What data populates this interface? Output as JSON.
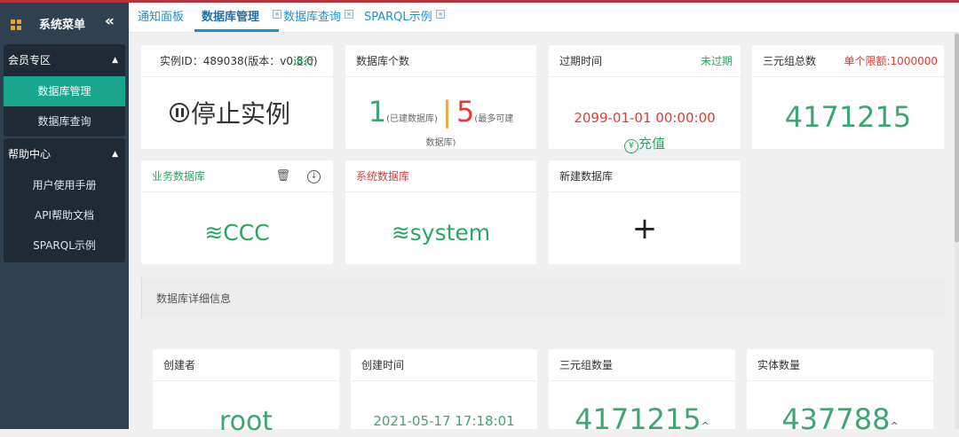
{
  "sidebar": {
    "title": "系统菜单",
    "collapse_icon": "«",
    "sections": [
      {
        "label": "会员专区",
        "items": [
          "数据库管理",
          "数据库查询"
        ],
        "active_index": 0
      },
      {
        "label": "帮助中心",
        "items": [
          "用户使用手册",
          "API帮助文档",
          "SPARQL示例"
        ]
      }
    ]
  },
  "tabs": [
    {
      "label": "通知面板"
    },
    {
      "label": "数据库管理",
      "active": true
    },
    {
      "label": "数据库查询"
    },
    {
      "label": "SPARQL示例"
    }
  ],
  "instance": {
    "title": "实例ID：489038(版本：v0.8.0)",
    "status": "运行",
    "action": "停止实例"
  },
  "db_count": {
    "title": "数据库个数",
    "created": "1",
    "created_label": "(已建数据库)",
    "separator": "|",
    "max": "5",
    "max_label_1": "(最多可建",
    "max_label_2": "数据库)"
  },
  "expiry": {
    "title": "过期时间",
    "status": "未过期",
    "date": "2099-01-01 00:00:00",
    "recharge": "充值",
    "yen": "¥"
  },
  "triples": {
    "title": "三元组总数",
    "limit": "单个限额:1000000",
    "value": "4171215"
  },
  "business_db": {
    "title": "业务数据库",
    "name": "CCC"
  },
  "system_db": {
    "title": "系统数据库",
    "name": "system"
  },
  "new_db": {
    "title": "新建数据库",
    "plus": "+"
  },
  "details": {
    "title": "数据库详细信息",
    "cards": [
      {
        "title": "创建者",
        "value": "root"
      },
      {
        "title": "创建时间",
        "value": "2021-05-17 17:18:01"
      },
      {
        "title": "三元组数量",
        "value": "4171215"
      },
      {
        "title": "实体数量",
        "value": "437788"
      }
    ]
  },
  "colors": {
    "accent": "#1aa58e",
    "sidebar": "#2f4050",
    "green": "#3fa572",
    "red": "#e53935"
  }
}
